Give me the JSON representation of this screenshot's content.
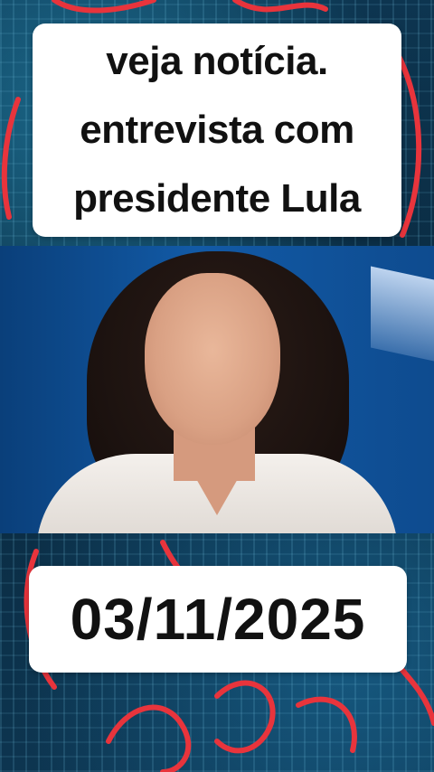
{
  "captions": {
    "top_lines": [
      "veja notícia.",
      "entrevista com",
      "presidente Lula"
    ],
    "date": "03/11/2025"
  },
  "colors": {
    "caption_bg": "#ffffff",
    "caption_text": "#111111",
    "scribble": "#e8343c",
    "background": "#0d3550",
    "video_backdrop": "#125aa6"
  }
}
